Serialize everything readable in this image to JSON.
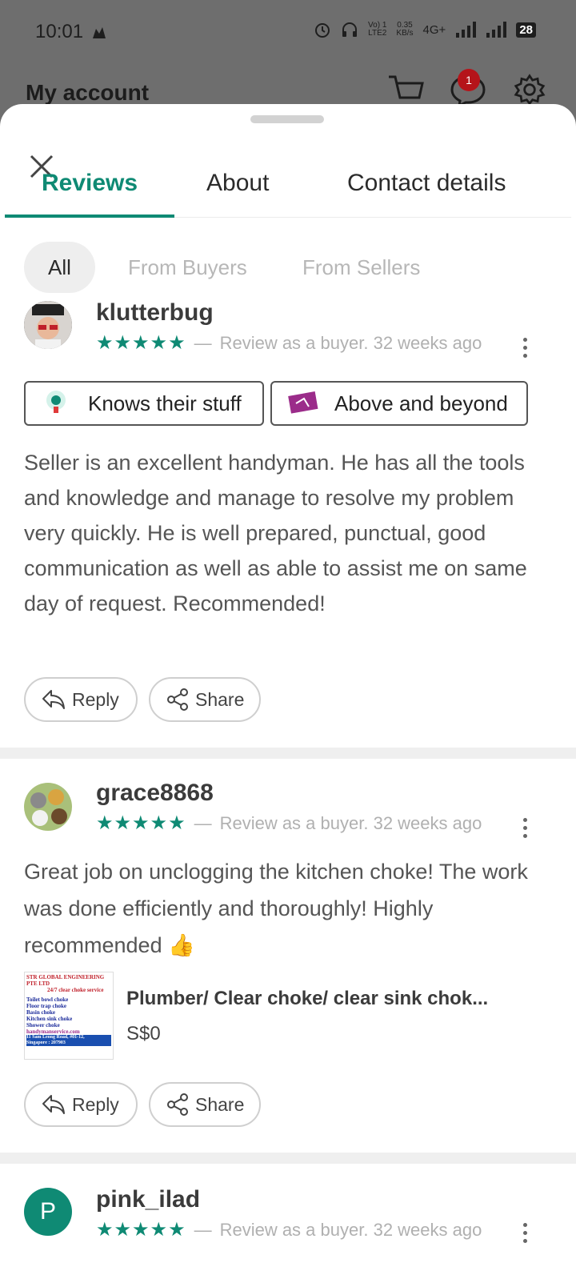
{
  "status_bar": {
    "time": "10:01",
    "net_top": "Vo) 1",
    "net_bottom": "LTE2",
    "speed_top": "0.35",
    "speed_bottom": "KB/s",
    "network": "4G+",
    "battery": "28"
  },
  "background": {
    "title": "My account",
    "notification_count": "1"
  },
  "tabs": [
    {
      "label": "Reviews",
      "active": true
    },
    {
      "label": "About",
      "active": false
    },
    {
      "label": "Contact details",
      "active": false
    }
  ],
  "filters": [
    {
      "label": "All",
      "active": true
    },
    {
      "label": "From Buyers",
      "active": false
    },
    {
      "label": "From Sellers",
      "active": false
    }
  ],
  "reviews": [
    {
      "username": "klutterbug",
      "rating": 5,
      "stars": "★★★★★",
      "dash": "—",
      "review_type": "Review as a buyer.",
      "time_ago": "32 weeks ago",
      "badges": [
        {
          "label": "Knows their stuff",
          "icon": "lightbulb-icon"
        },
        {
          "label": "Above and beyond",
          "icon": "ticket-icon"
        }
      ],
      "text": "Seller is an excellent handyman. He has all the tools and knowledge and manage to resolve my problem very quickly. He is well prepared, punctual, good communication as well as able to assist me on same day of request. Recommended!",
      "reply_label": "Reply",
      "share_label": "Share"
    },
    {
      "username": "grace8868",
      "rating": 5,
      "stars": "★★★★★",
      "dash": "—",
      "review_type": "Review as a buyer.",
      "time_ago": "32 weeks ago",
      "text": "Great job on unclogging the kitchen choke! The work was done efficiently and thoroughly! Highly recommended 👍",
      "listing": {
        "title": "Plumber/ Clear choke/ clear sink chok...",
        "price": "S$0",
        "image_lines": [
          "STR GLOBAL ENGINEERING PTE LTD",
          "24/7 clear choke service",
          "Toilet bowl choke",
          "Floor trap choke",
          "Basin choke",
          "Kitchen sink choke",
          "Shower choke",
          "handymanservice.com",
          "11 Sam Leong Road, #01-12,",
          "Singapore : 207903"
        ]
      },
      "reply_label": "Reply",
      "share_label": "Share"
    },
    {
      "username": "pink_ilad",
      "avatar_letter": "P",
      "rating": 5,
      "stars": "★★★★★",
      "dash": "—",
      "review_type": "Review as a buyer.",
      "time_ago": "32 weeks ago"
    }
  ],
  "colors": {
    "accent": "#0f8a74",
    "notification": "#b5141a"
  }
}
